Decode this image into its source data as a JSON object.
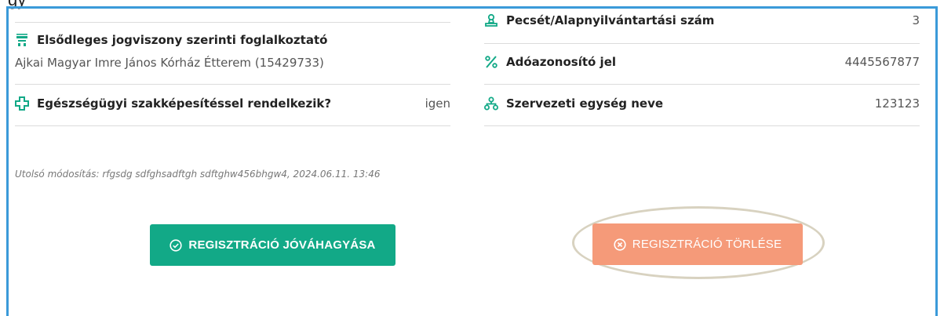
{
  "header_cut_text": "gy",
  "left": {
    "employer_label": "Elsődleges jogviszony szerinti foglalkoztató",
    "employer_value": "Ajkai Magyar Imre János Kórház Étterem (15429733)",
    "qualification_label": "Egészségügyi szakképesítéssel rendelkezik?",
    "qualification_value": "igen",
    "last_modified": "Utolsó módosítás: rfgsdg sdfghsadftgh sdftghw456bhgw4, 2024.06.11. 13:46"
  },
  "right": {
    "stamp_label": "Pecsét/Alapnyilvántartási szám",
    "stamp_value": "3",
    "tax_label": "Adóazonosító jel",
    "tax_value": "4445567877",
    "unit_label": "Szervezeti egység neve",
    "unit_value": "123123"
  },
  "buttons": {
    "approve_label": "REGISZTRÁCIÓ JÓVÁHAGYÁSA",
    "delete_label": "REGISZTRÁCIÓ TÖRLÉSE"
  },
  "colors": {
    "accent_green": "#12a987",
    "delete_orange": "#f59a79",
    "frame_blue": "#3a9ad9"
  },
  "icons": {
    "employer": "building-icon",
    "qualification": "plus-cross-icon",
    "stamp": "stamp-icon",
    "tax": "percent-icon",
    "unit": "sitemap-icon",
    "approve": "check-circle-icon",
    "delete": "x-circle-icon"
  }
}
